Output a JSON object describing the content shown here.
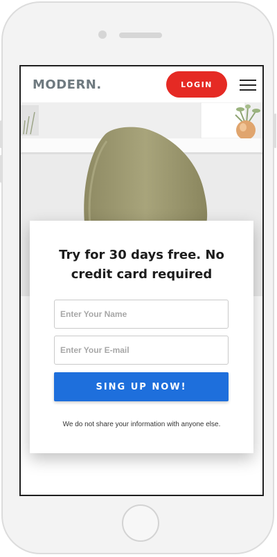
{
  "device": {
    "frame_color": "#f3f3f3",
    "screen_border_color": "#1e1e1e"
  },
  "navbar": {
    "logo": "MODERN.",
    "login_label": "LOGIN",
    "login_color": "#e52a24",
    "menu_icon": "hamburger-menu-icon"
  },
  "hero": {
    "image": "chair-on-desk-photo"
  },
  "signup_card": {
    "title": "Try for 30 days free. No credit card required",
    "name_placeholder": "Enter Your Name",
    "name_value": "",
    "email_placeholder": "Enter Your E-mail",
    "email_value": "",
    "submit_label": "SING UP NOW!",
    "submit_color": "#1e6fdc",
    "disclaimer": "We do not share your information with anyone else."
  }
}
